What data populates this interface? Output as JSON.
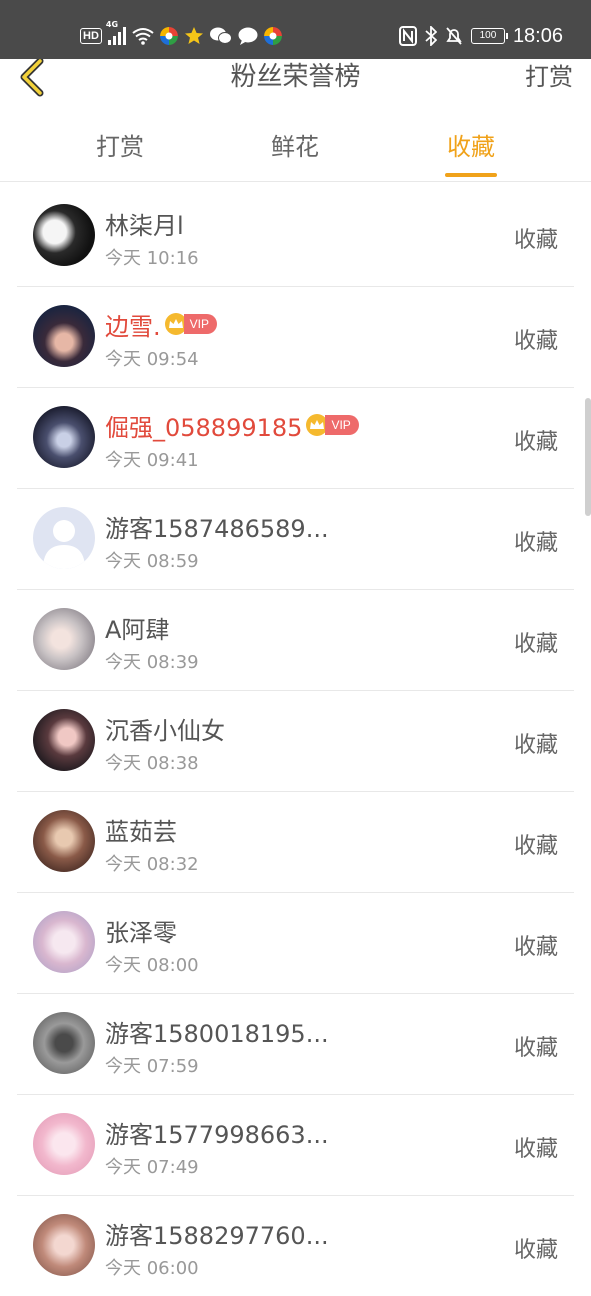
{
  "status_bar": {
    "time": "18:06",
    "hd_label": "HD",
    "network_label": "4G",
    "battery": "100"
  },
  "header": {
    "title": "粉丝荣誉榜",
    "right_action": "打赏"
  },
  "tabs": [
    {
      "label": "打赏",
      "active": false
    },
    {
      "label": "鲜花",
      "active": false
    },
    {
      "label": "收藏",
      "active": true
    }
  ],
  "list": [
    {
      "name": "林柒月l",
      "time": "今天 10:16",
      "action": "收藏",
      "vip": false
    },
    {
      "name": "边雪.",
      "time": "今天 09:54",
      "action": "收藏",
      "vip": true,
      "vip_label": "VIP"
    },
    {
      "name": "倔强_058899185",
      "time": "今天 09:41",
      "action": "收藏",
      "vip": true,
      "vip_label": "VIP"
    },
    {
      "name": "游客1587486589...",
      "time": "今天 08:59",
      "action": "收藏",
      "vip": false
    },
    {
      "name": "A阿肆",
      "time": "今天 08:39",
      "action": "收藏",
      "vip": false
    },
    {
      "name": "沉香小仙女",
      "time": "今天 08:38",
      "action": "收藏",
      "vip": false
    },
    {
      "name": "蓝茹芸",
      "time": "今天 08:32",
      "action": "收藏",
      "vip": false
    },
    {
      "name": "张泽零",
      "time": "今天 08:00",
      "action": "收藏",
      "vip": false
    },
    {
      "name": "游客1580018195...",
      "time": "今天 07:59",
      "action": "收藏",
      "vip": false
    },
    {
      "name": "游客1577998663...",
      "time": "今天 07:49",
      "action": "收藏",
      "vip": false
    },
    {
      "name": "游客1588297760...",
      "time": "今天 06:00",
      "action": "收藏",
      "vip": false
    }
  ],
  "colors": {
    "accent": "#f0a21a",
    "vip_name": "#e14a3c",
    "vip_badge": "#ee6a6a",
    "status_bar": "#4a4a4a"
  }
}
